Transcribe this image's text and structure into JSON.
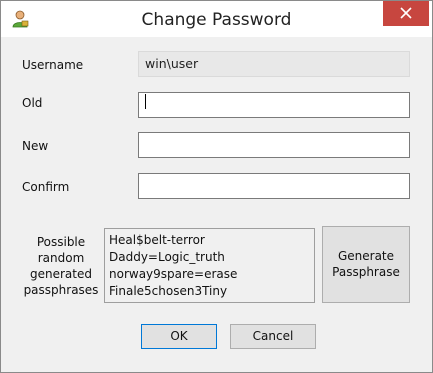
{
  "window": {
    "title": "Change Password",
    "icon": "user-key-icon",
    "close_icon": "close-icon"
  },
  "form": {
    "username_label": "Username",
    "username_value": "win\\user",
    "old_label": "Old",
    "old_value": "",
    "new_label": "New",
    "new_value": "",
    "confirm_label": "Confirm",
    "confirm_value": ""
  },
  "passphrases": {
    "label_lines": [
      "Possible",
      "random",
      "generated",
      "passphrases"
    ],
    "items": [
      "Heal$belt-terror",
      "Daddy=Logic_truth",
      "norway9spare=erase",
      "Finale5chosen3Tiny"
    ],
    "generate_label_lines": [
      "Generate",
      "Passphrase"
    ]
  },
  "buttons": {
    "ok": "OK",
    "cancel": "Cancel"
  },
  "colors": {
    "close_button": "#c7463f",
    "dialog_background": "#f0f0f0",
    "focus_border": "#0078d7"
  }
}
